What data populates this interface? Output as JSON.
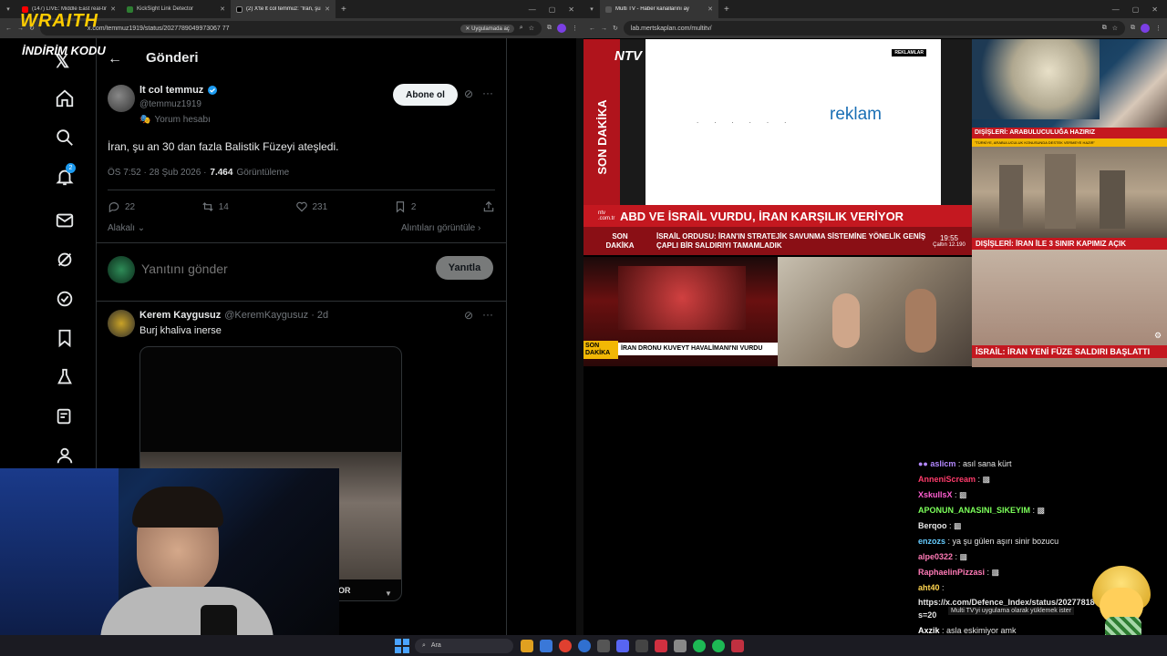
{
  "left_browser": {
    "tabs": [
      {
        "label": "(147) LIVE: Middle East real-tim",
        "color": "#ff0000"
      },
      {
        "label": "KickSight Link Detector",
        "color": "#2e7d32"
      },
      {
        "label": "(2) X'te lt col temmuz: \"İran, şu",
        "color": "#000000"
      }
    ],
    "url": "x.com/temmuz1919/status/2027789049973067 77",
    "open_app": "Uygulamada aç",
    "new_tab": "+"
  },
  "overlay": {
    "brand": "WRAITH",
    "promo": "İNDİRİM KODU"
  },
  "x_app": {
    "page_title": "Gönderi",
    "post": {
      "name": "lt col temmuz",
      "handle": "@temmuz1919",
      "badge": "Yorum hesabı",
      "follow": "Abone ol",
      "text": "İran, şu an 30 dan fazla Balistik Füzeyi ateşledi.",
      "meta_time": "ÖS 7:52 · 28 Şub 2026 ·",
      "views_count": "7.464",
      "views_label": "Görüntüleme",
      "replies": "22",
      "reposts": "14",
      "likes": "231",
      "bookmarks": "2",
      "sort_label": "Alakalı",
      "quotes_link": "Alıntıları görüntüle"
    },
    "compose": {
      "placeholder": "Yanıtını gönder",
      "button": "Yanıtla"
    },
    "reply": {
      "name": "Kerem Kaygusuz",
      "handle": "@KeremKaygusuz · 2d",
      "text": "Burj khaliva inerse"
    },
    "video_caption": "OR"
  },
  "right_browser": {
    "tab": "Multi TV - Haber kanallarını ay",
    "url": "lab.mertskaplan.com/multitv/",
    "new_tab": "+"
  },
  "multitv": {
    "ntv_sidebar": "SON DAKİKA",
    "ntv_logo": "NTV",
    "ad_badge": "REKLAMLAR",
    "ad_text": "reklam",
    "headline": "ABD VE İSRAİL VURDU, İRAN KARŞILIK VERİYOR",
    "ticker_label_1": "SON",
    "ticker_label_2": "DAKİKA",
    "ticker": "İSRAİL ORDUSU: İRAN'IN STRATEJİK SAVUNMA SİSTEMİNE YÖNELİK GENİŞ ÇAPLI BİR SALDIRIYI TAMAMLADIK",
    "clock": "19:55",
    "clock_sub": "Çaltın 12.190",
    "cnn_banner": "DIŞİŞLERİ: ARABULUCULUĞA HAZIRIZ",
    "cnn_sub": "\"TÜRKİYE, ARABULUCULUK KONUSUNDA DESTEK VERMEYE HAZIR\"",
    "tile_mid_banner": "DIŞİŞLERİ: İRAN İLE 3 SINIR KAPIMIZ AÇIK",
    "tile_low_left": "İRAN DRONU KUVEYT HAVALİMANI'NI VURDU",
    "tile_low_left_tag": "SON DAKİKA",
    "tile_low_right": "İSRAİL: İRAN YENİ FÜZE SALDIRI BAŞLATTI"
  },
  "chat": [
    {
      "user": "aslicm",
      "msg": "asıl sana kürt",
      "color": "#b388ff"
    },
    {
      "user": "AnneniScream",
      "msg": "▩",
      "color": "#ff3b6b"
    },
    {
      "user": "XskullsX",
      "msg": "▩",
      "color": "#ff5fd2"
    },
    {
      "user": "APONUN_ANASINI_SIKEYIM",
      "msg": "▩",
      "color": "#7cff5a"
    },
    {
      "user": "Berqoo",
      "msg": "▩",
      "color": "#e6e6e6"
    },
    {
      "user": "enzozs",
      "msg": "ya şu gülen aşırı sinir bozucu",
      "color": "#66ccff"
    },
    {
      "user": "alpe0322",
      "msg": "▩",
      "color": "#ff7ab6"
    },
    {
      "user": "RaphaelinPizzasi",
      "msg": "▩",
      "color": "#ff7ab6"
    },
    {
      "user": "aht40",
      "msg": "",
      "color": "#ffd54f"
    },
    {
      "user": "",
      "msg": "https://x.com/Defence_Index/status/2027781843313730137",
      "color": "#ffffff"
    },
    {
      "user": "",
      "msg": "s=20",
      "color": "#ffffff"
    },
    {
      "user": "Axzik",
      "msg": "asla eskimiyor amk",
      "color": "#ffffff"
    },
    {
      "user": "zaii",
      "msg": "▩",
      "color": "#ffd54f"
    }
  ],
  "toast": "Multi TV'yi uygulama olarak yüklemek ister",
  "taskbar": {
    "search": "Ara"
  }
}
